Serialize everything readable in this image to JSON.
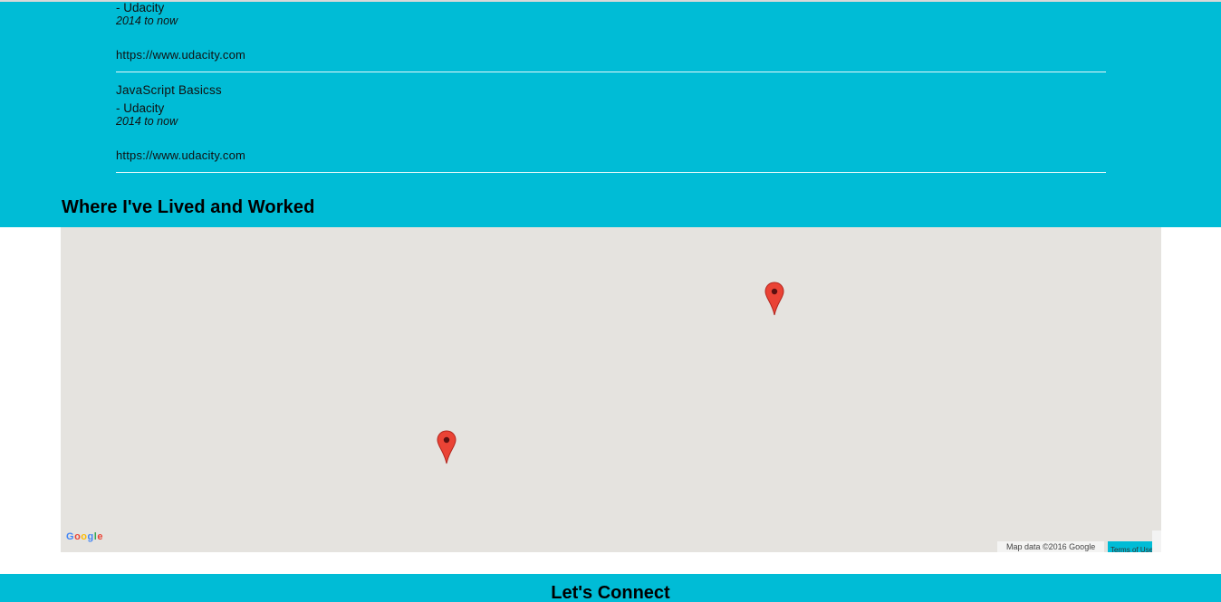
{
  "education": {
    "online_courses": [
      {
        "title": "",
        "school": "- Udacity",
        "dates": "2014 to now",
        "url": "https://www.udacity.com"
      },
      {
        "title": "JavaScript Basicss",
        "school": "- Udacity",
        "dates": "2014 to now",
        "url": "https://www.udacity.com"
      }
    ]
  },
  "map_section": {
    "heading": "Where I've Lived and Worked",
    "background_color": "#e5e3df",
    "marker_color": "#ea4335",
    "marker_icon": "map-pin-icon",
    "markers_count_label": "",
    "attribution": "Map data ©2016 Google",
    "terms_label": "Terms of Use",
    "logo_letters": [
      "G",
      "o",
      "o",
      "g",
      "l",
      "e"
    ],
    "logo_colors": [
      "#4285f4",
      "#ea4335",
      "#fbbc05",
      "#4285f4",
      "#34a853",
      "#ea4335"
    ]
  },
  "connect_section": {
    "heading": "Let's Connect"
  },
  "colors": {
    "accent": "#00bcd6",
    "page_background": "#ffffff"
  }
}
